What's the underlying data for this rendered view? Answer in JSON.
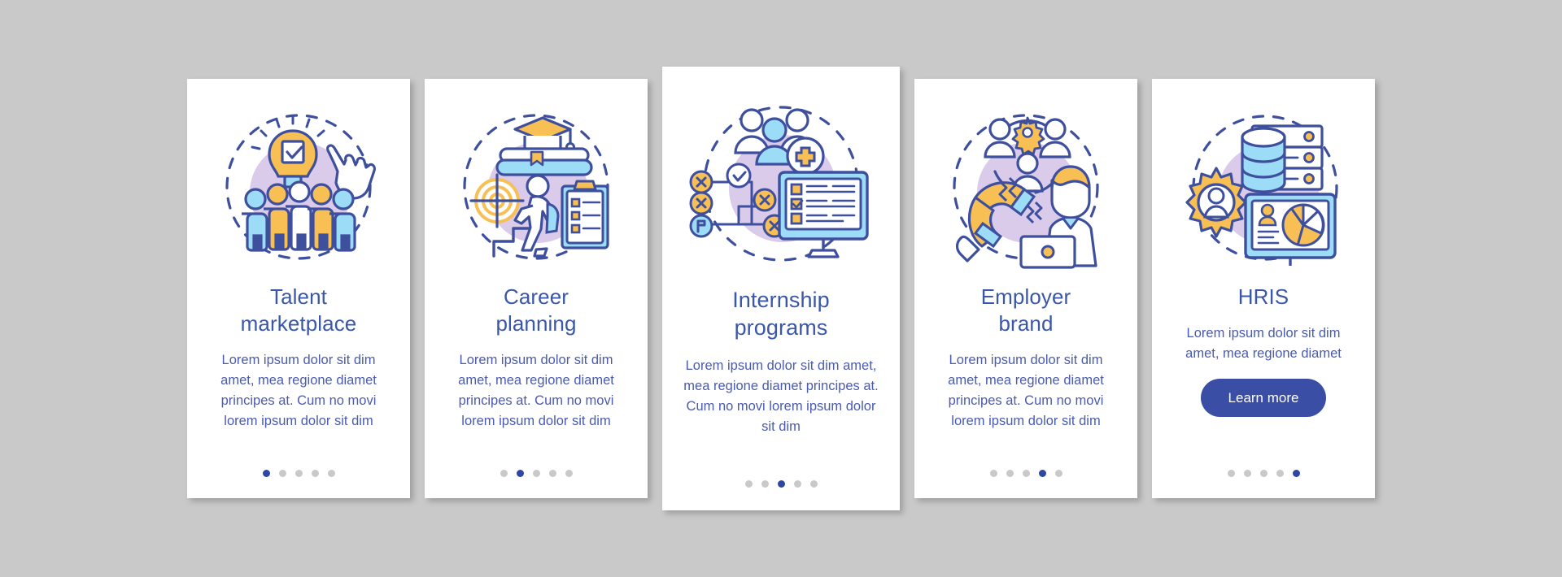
{
  "theme": {
    "page_background": "#c9c9c9",
    "card_background": "#ffffff",
    "title_color": "#3a57a8",
    "body_color": "#4a5bb0",
    "accent_blue": "#3b4ea5",
    "dot_inactive": "#c9c9c9",
    "dot_active": "#2f47a0",
    "illustration_outline": "#3e4f9e",
    "illustration_light_blue": "#8fd3f4",
    "illustration_yellow": "#f7bf54",
    "illustration_purple_blob": "#d9cbe9"
  },
  "screens": [
    {
      "id": "talent-marketplace",
      "illustration": "lightbulb-check-people-cursor",
      "title": "Talent\nmarketplace",
      "title_lines": [
        "Talent",
        "marketplace"
      ],
      "description": "Lorem ipsum dolor sit dim amet, mea regione diamet principes at. Cum no movi lorem ipsum dolor sit dim",
      "has_button": false,
      "button_label": "",
      "dots": {
        "count": 5,
        "active_index": 0
      }
    },
    {
      "id": "career-planning",
      "illustration": "graduation-cap-books-target-stairs-clipboard",
      "title": "Career\nplanning",
      "title_lines": [
        "Career",
        "planning"
      ],
      "description": "Lorem ipsum dolor sit dim amet, mea regione diamet principes at. Cum no movi lorem ipsum dolor sit dim",
      "has_button": false,
      "button_label": "",
      "dots": {
        "count": 5,
        "active_index": 1
      }
    },
    {
      "id": "internship-programs",
      "illustration": "people-plus-flowchart-monitor-checklist",
      "title": "Internship\nprograms",
      "title_lines": [
        "Internship",
        "programs"
      ],
      "description": "Lorem ipsum dolor sit dim amet, mea regione diamet principes at. Cum no movi lorem ipsum dolor sit dim",
      "has_button": false,
      "button_label": "",
      "dots": {
        "count": 5,
        "active_index": 2
      }
    },
    {
      "id": "employer-brand",
      "illustration": "magnet-attracting-people-gear-laptop-worker",
      "title": "Employer\nbrand",
      "title_lines": [
        "Employer",
        "brand"
      ],
      "description": "Lorem ipsum dolor sit dim amet, mea regione diamet principes at. Cum no movi lorem ipsum dolor sit dim",
      "has_button": false,
      "button_label": "",
      "dots": {
        "count": 5,
        "active_index": 3
      }
    },
    {
      "id": "hris",
      "illustration": "gear-user-database-server-monitor-pie-chart",
      "title": "HRIS",
      "title_lines": [
        "HRIS"
      ],
      "description": "Lorem ipsum dolor sit dim amet, mea regione diamet",
      "has_button": true,
      "button_label": "Learn more",
      "dots": {
        "count": 5,
        "active_index": 4
      }
    }
  ]
}
